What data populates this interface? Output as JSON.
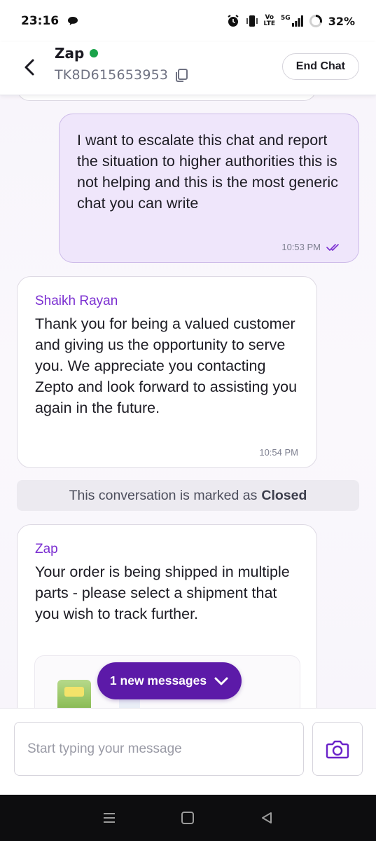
{
  "status_bar": {
    "time": "23:16",
    "network_label_top": "Vo",
    "network_label_bottom": "LTE",
    "signal_label": "5G",
    "battery": "32%"
  },
  "header": {
    "title": "Zap",
    "ticket_id": "TK8D615653953",
    "end_chat_label": "End Chat",
    "online_color": "#1aa34a"
  },
  "messages": {
    "outgoing": {
      "text": "I want to escalate this chat and report the situation to higher authorities this is not helping and this is the most generic chat you can write",
      "time": "10:53 PM"
    },
    "agent": {
      "sender": "Shaikh Rayan",
      "text": "Thank you for being a valued customer and giving us the opportunity to serve you. We appreciate you contacting Zepto and look forward to assisting you again in the future.",
      "time": "10:54 PM"
    },
    "closed_banner": {
      "prefix": "This conversation is marked as",
      "status": "Closed"
    },
    "zap": {
      "sender": "Zap",
      "text": "Your order is being shipped in multiple parts - please select a shipment that you wish to track further."
    }
  },
  "new_messages_pill": {
    "label": "1 new messages"
  },
  "composer": {
    "placeholder": "Start typing your message",
    "value": ""
  },
  "colors": {
    "accent": "#7b2fd1",
    "pill": "#5c1aa8",
    "outgoing_bubble": "#efe6fb"
  }
}
